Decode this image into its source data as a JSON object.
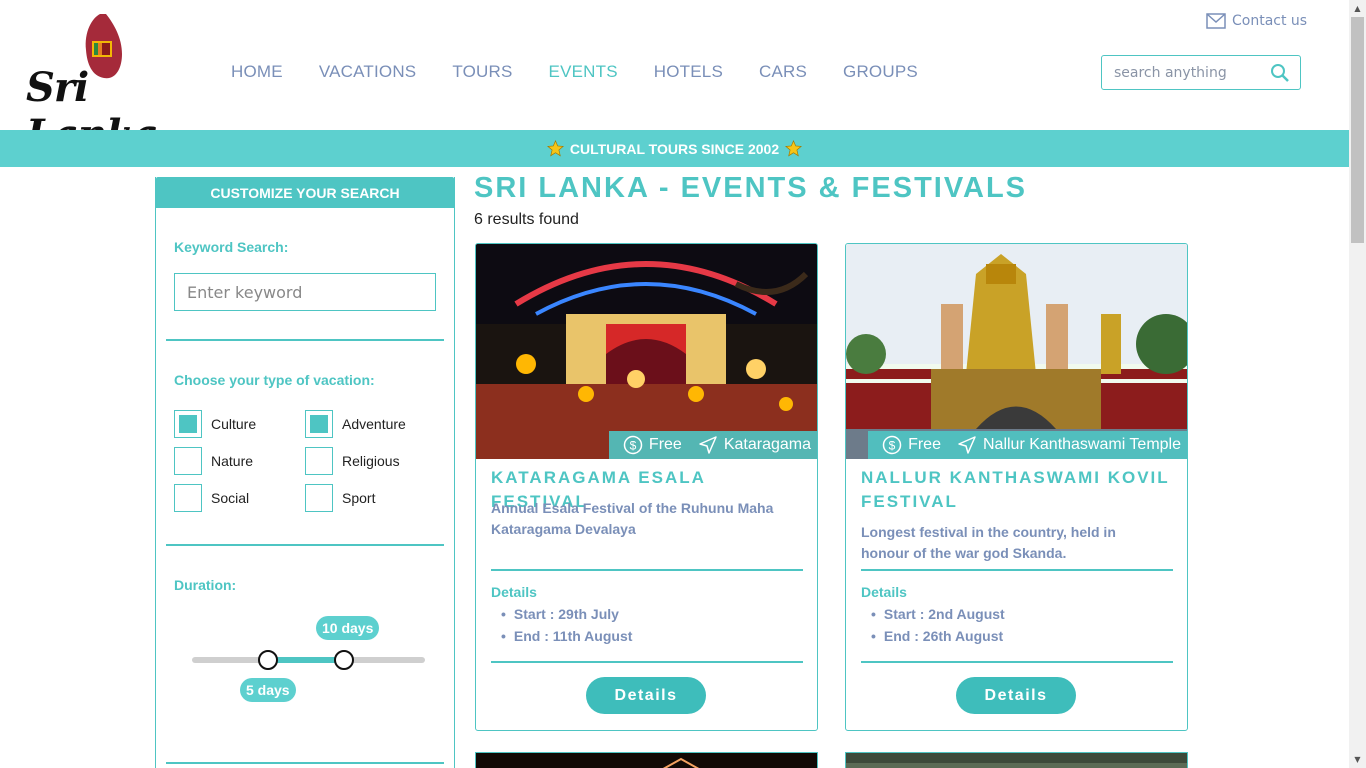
{
  "header": {
    "logo_text": "Sri Lanka",
    "contact_label": "Contact us",
    "search_placeholder": "search anything",
    "nav": [
      {
        "label": "HOME"
      },
      {
        "label": "VACATIONS"
      },
      {
        "label": "TOURS"
      },
      {
        "label": "EVENTS",
        "active": true
      },
      {
        "label": "HOTELS"
      },
      {
        "label": "CARS"
      },
      {
        "label": "GROUPS"
      }
    ]
  },
  "banner": {
    "text": "CULTURAL TOURS SINCE 2002"
  },
  "sidebar": {
    "title": "CUSTOMIZE YOUR SEARCH",
    "keyword_label": "Keyword Search:",
    "keyword_placeholder": "Enter keyword",
    "vacation_label": "Choose your type of vacation:",
    "types": [
      {
        "label": "Culture",
        "checked": true
      },
      {
        "label": "Adventure",
        "checked": true
      },
      {
        "label": "Nature",
        "checked": false
      },
      {
        "label": "Religious",
        "checked": false
      },
      {
        "label": "Social",
        "checked": false
      },
      {
        "label": "Sport",
        "checked": false
      }
    ],
    "duration_label": "Duration:",
    "duration_min_label": "5 days",
    "duration_max_label": "10 days"
  },
  "main": {
    "title": "SRI LANKA - EVENTS & FESTIVALS",
    "results": "6 results found",
    "cards": [
      {
        "price": "Free",
        "location": "Kataragama",
        "title": "KATARAGAMA ESALA FESTIVAL",
        "description": "Annual Esala Festival of the Ruhunu Maha Kataragama Devalaya",
        "details_label": "Details",
        "start": "Start : 29th July",
        "end": "End : 11th August",
        "button": "Details"
      },
      {
        "price": "Free",
        "location": "Nallur Kanthaswami Temple",
        "title": "NALLUR KANTHASWAMI KOVIL FESTIVAL",
        "description": "Longest festival in the country, held in honour of the war god Skanda.",
        "details_label": "Details",
        "start": "Start : 2nd August",
        "end": "End : 26th August",
        "button": "Details"
      }
    ]
  },
  "colors": {
    "accent": "#4ec5c3",
    "nav_text": "#7a8fb8",
    "banner": "#5dd0cf"
  }
}
